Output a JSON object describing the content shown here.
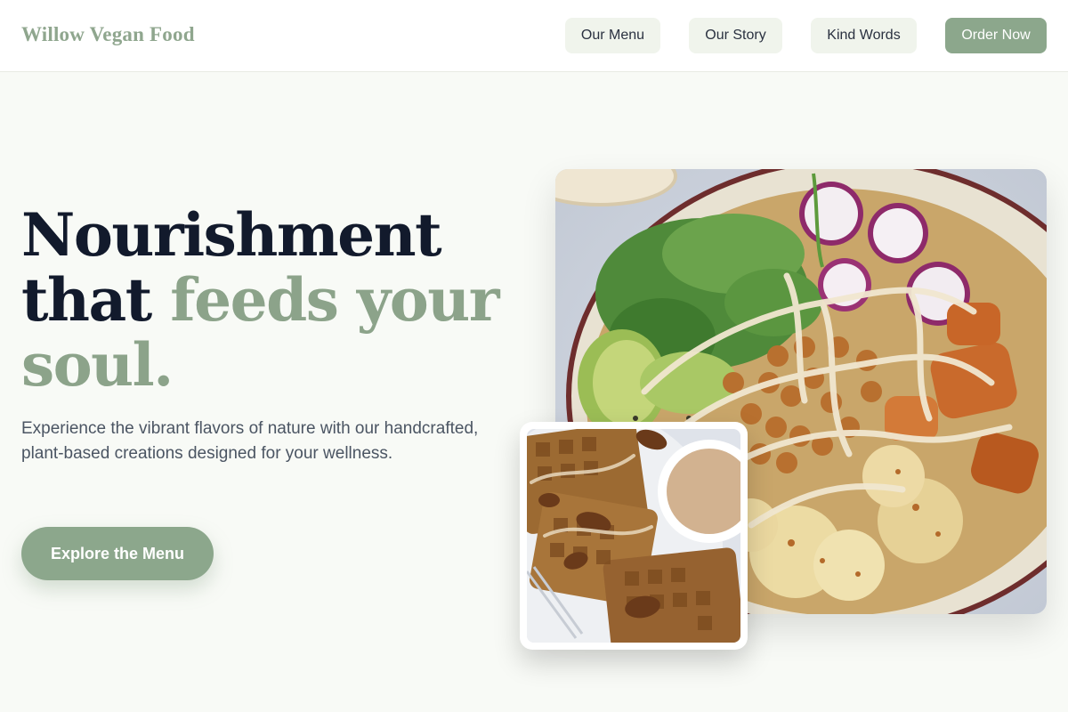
{
  "brand": {
    "name": "Willow Vegan Food"
  },
  "nav": {
    "items": [
      {
        "label": "Our Menu"
      },
      {
        "label": "Our Story"
      },
      {
        "label": "Kind Words"
      }
    ],
    "order_label": "Order Now"
  },
  "hero": {
    "title_line1": "Nourishment",
    "title_line2_plain": "that ",
    "title_line2_accent": "feeds your",
    "title_line3_accent": "soul.",
    "subtitle": "Experience the vibrant flavors of nature with our handcrafted, plant-based creations designed for your wellness.",
    "cta_label": "Explore the Menu"
  },
  "images": {
    "main": "buddha-bowl-photo",
    "inset": "pumpkin-waffles-photo"
  },
  "colors": {
    "brand": "#8fa68e",
    "accent_button": "#8ca78c",
    "nav_button_bg": "#f0f4ec",
    "page_bg": "#f8faf6",
    "heading": "#121a2c",
    "body_text": "#4b5563"
  }
}
